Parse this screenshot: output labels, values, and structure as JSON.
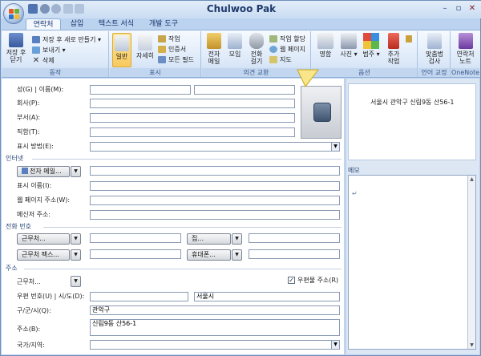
{
  "window": {
    "title": "Chulwoo Pak"
  },
  "tabs": [
    "연락처",
    "삽입",
    "텍스트 서식",
    "개발 도구"
  ],
  "ribbon": {
    "groups": {
      "actions": {
        "label": "동작",
        "save_close": "저장 후\n닫기",
        "save_new": "저장 후 새로 만들기",
        "forward": "보내기",
        "delete": "삭제"
      },
      "show": {
        "label": "표시",
        "general": "일반",
        "details": "자세히",
        "activities": "작업",
        "certificates": "인증서",
        "all_fields": "모든 필드"
      },
      "communicate": {
        "label": "의견 교환",
        "email": "전자\n메일",
        "meeting": "모임",
        "call": "전화\n걸기",
        "assign_task": "작업 할당",
        "web_page": "웹 페이지",
        "map": "지도"
      },
      "options": {
        "label": "옵션",
        "business_card": "명함",
        "picture": "사진",
        "categorize": "범주",
        "follow_up": "추가\n작업"
      },
      "proofing": {
        "label": "언어 교정",
        "spelling": "맞춤법\n검사"
      },
      "onenote": {
        "label": "OneNote",
        "contact_notes": "연락처\n노트"
      }
    }
  },
  "form": {
    "fullname_label": "성(G) | 이름(M):",
    "company_label": "회사(P):",
    "department_label": "부서(A):",
    "jobtitle_label": "직함(T):",
    "fileas_label": "표시 방법(E):",
    "internet_section": "인터넷",
    "email_button": "전자 메일...",
    "displayas_label": "표시 이름(I):",
    "webpage_label": "웹 페이지 주소(W):",
    "im_label": "메신저 주소:",
    "phone_section": "전화 번호",
    "business_phone": "근무처...",
    "home_phone": "집...",
    "business_fax": "근무처 팩스...",
    "mobile_phone": "휴대폰...",
    "address_section": "주소",
    "address_type": "근무처...",
    "mailing_address_label": "우편물 주소(R)",
    "mailing_checked": "✓",
    "zip_city_label": "우편 번호(U) | 시/도(D):",
    "city_value": "서울시",
    "district_label": "구/군/시(Q):",
    "district_value": "관악구",
    "street_label": "주소(B):",
    "street_value": "신림9동 산56-1",
    "country_label": "국가/지역:"
  },
  "card": {
    "address": "서울시 관악구 신림9동 산56-1"
  },
  "memo": {
    "label": "메모",
    "caret": "↵"
  },
  "colors": {
    "accent": "#f8c95d",
    "ribbon_bg": "#dbe8f8",
    "frame": "#bcd3ef"
  }
}
